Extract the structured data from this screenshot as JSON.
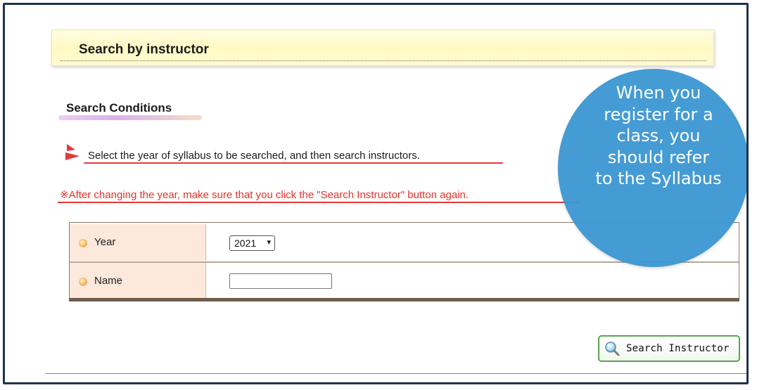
{
  "header": {
    "title": "Search by instructor"
  },
  "conditions": {
    "title": "Search Conditions",
    "instruction": "Select the year of syllabus to be searched, and then search instructors.",
    "notice": "※After changing the year, make sure that you click the \"Search Instructor\" button again.",
    "year_label": "Year",
    "year_value": "2021",
    "name_label": "Name",
    "name_value": ""
  },
  "search_button": {
    "label": "Search Instructor"
  },
  "callout": {
    "lines": [
      "When you",
      "register for a",
      "class, you",
      "should refer",
      "to the Syllabus"
    ]
  },
  "icons": {
    "instruction_marker": "red-arrow-marker-icon",
    "row_bullet": "orange-dot-icon",
    "search": "magnifier-icon",
    "select_caret": "chevron-down-icon"
  },
  "colors": {
    "frame": "#1f3349",
    "header_band": "#fff9c4",
    "notice_red": "#e5312b",
    "label_cell": "#fde9dc",
    "button_border": "#5aa64e",
    "callout_blue": "#3e97d3"
  }
}
